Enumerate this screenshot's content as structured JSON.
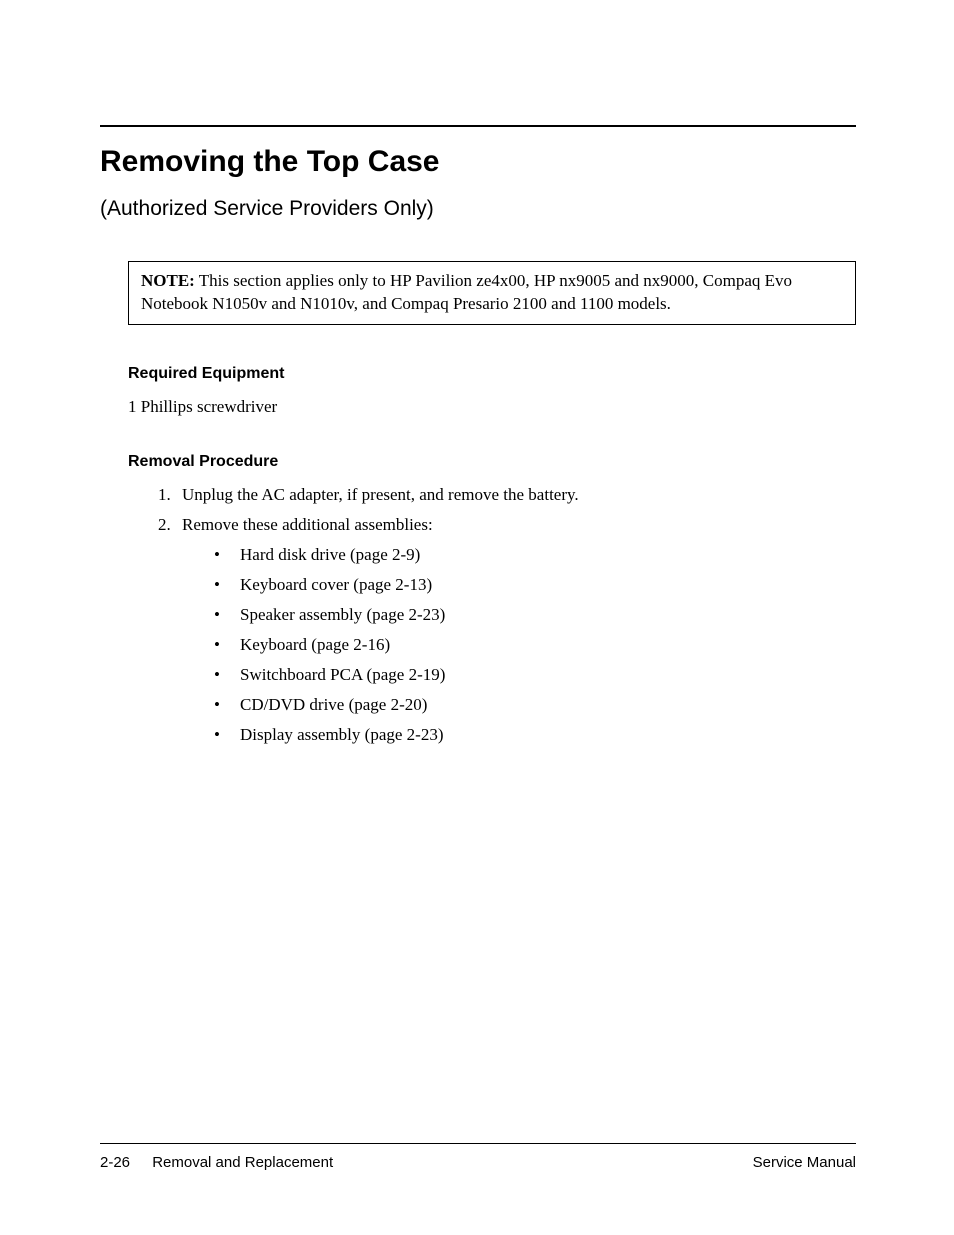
{
  "title": "Removing the Top Case",
  "subtitle": "(Authorized Service Providers Only)",
  "note": {
    "label": "NOTE:",
    "text": " This section applies only to HP Pavilion ze4x00, HP nx9005 and nx9000, Compaq Evo Notebook N1050v and N1010v, and Compaq Presario 2100 and 1100 models."
  },
  "sections": {
    "equipment_heading": "Required Equipment",
    "equipment_item": "1 Phillips screwdriver",
    "procedure_heading": "Removal Procedure"
  },
  "steps": [
    {
      "num": "1.",
      "text": "Unplug the AC adapter, if present, and remove the battery."
    },
    {
      "num": "2.",
      "text": "Remove these additional assemblies:"
    }
  ],
  "assemblies": [
    "Hard disk drive (page 2-9)",
    "Keyboard cover (page 2-13)",
    "Speaker assembly (page 2-23)",
    "Keyboard (page 2-16)",
    "Switchboard PCA (page 2-19)",
    "CD/DVD drive (page 2-20)",
    "Display assembly (page 2-23)"
  ],
  "footer": {
    "page_number": "2-26",
    "section": "Removal and Replacement",
    "manual": "Service Manual"
  }
}
